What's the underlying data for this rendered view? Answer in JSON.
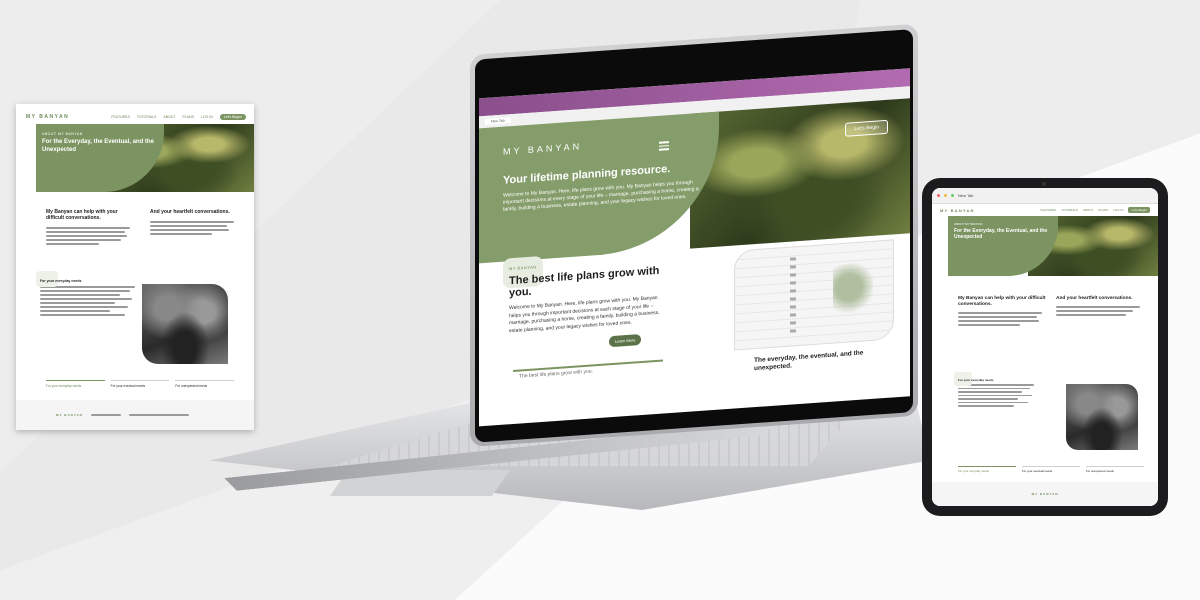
{
  "brand": {
    "logo": "MY BANYAN",
    "accent": "#7b9461",
    "accent_dark": "#5c7349"
  },
  "nav": {
    "items": [
      "FEATURES",
      "TUTORIALS",
      "ABOUT",
      "PLANS",
      "LOG IN"
    ],
    "cta": "Let's Begin!"
  },
  "about_hero": {
    "eyebrow": "ABOUT MY BANYAN",
    "heading": "For the Everyday, the Eventual, and the Unexpected"
  },
  "about_cols": {
    "left_heading": "My Banyan can help with your difficult conversations.",
    "right_heading": "And your heartfelt conversations."
  },
  "about_section2": {
    "heading": "For your everyday needs"
  },
  "about_tabs": [
    "For your everyday needs",
    "For your eventual needs",
    "For unexpected needs"
  ],
  "laptop": {
    "tab_label": "New Tab",
    "hero_cta": "Let's Begin",
    "hero_title": "Your lifetime planning resource.",
    "hero_copy": "Welcome to My Banyan. Here, life plans grow with you. My Banyan helps you through important decisions at every stage of your life – marriage, purchasing a home, creating a family, building a business, estate planning, and your legacy wishes for loved ones.",
    "section_eyebrow": "MY BANYAN",
    "section_heading": "The best life plans grow with you.",
    "section_copy": "Welcome to My Banyan. Here, life plans grow with you. My Banyan helps you through important decisions at each stage of your life – marriage, purchasing a home, creating a family, building a business, estate planning, and your legacy wishes for loved ones.",
    "section_button": "Learn More",
    "bottom_left": "The best life plans grow with you.",
    "bottom_right": "The everyday, the eventual, and the unexpected."
  },
  "tablet": {
    "tab_label": "New Tab"
  }
}
